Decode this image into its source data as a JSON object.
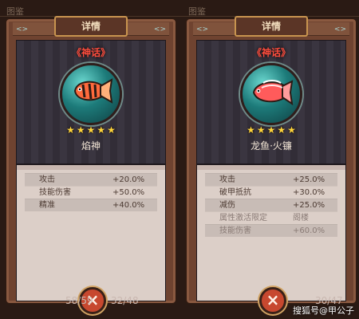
{
  "background": {
    "top_left_label": "图鉴",
    "bottom_numbers": [
      "58/59",
      "32/48",
      "30/47"
    ]
  },
  "panels": [
    {
      "tab_label": "详情",
      "rarity_label": "《神话》",
      "fish_name": "焰神",
      "stars": 5,
      "fish_colors": {
        "body": "#ff6a3c",
        "stripe": "#2a1a14",
        "fin": "#ffb07a"
      },
      "stats": [
        {
          "name": "攻击",
          "value": "+20.0%",
          "muted": false
        },
        {
          "name": "技能伤害",
          "value": "+50.0%",
          "muted": false
        },
        {
          "name": "精准",
          "value": "+40.0%",
          "muted": false
        }
      ],
      "close_icon": "close-icon",
      "close_label": "×"
    },
    {
      "tab_label": "详情",
      "rarity_label": "《神话》",
      "fish_name": "龙鱼·火镰",
      "stars": 5,
      "fish_colors": {
        "body": "#ff5b5b",
        "stripe": "#ffffff",
        "fin": "#ff9c9c"
      },
      "stats": [
        {
          "name": "攻击",
          "value": "+25.0%",
          "muted": false
        },
        {
          "name": "破甲抵抗",
          "value": "+30.0%",
          "muted": false
        },
        {
          "name": "减伤",
          "value": "+25.0%",
          "muted": false
        },
        {
          "name": "属性激活限定",
          "value": "阁楼",
          "muted": true
        },
        {
          "name": "技能伤害",
          "value": "+60.0%",
          "muted": true
        }
      ],
      "close_icon": "close-icon",
      "close_label": "×"
    }
  ],
  "watermark": "搜狐号@甲公子"
}
